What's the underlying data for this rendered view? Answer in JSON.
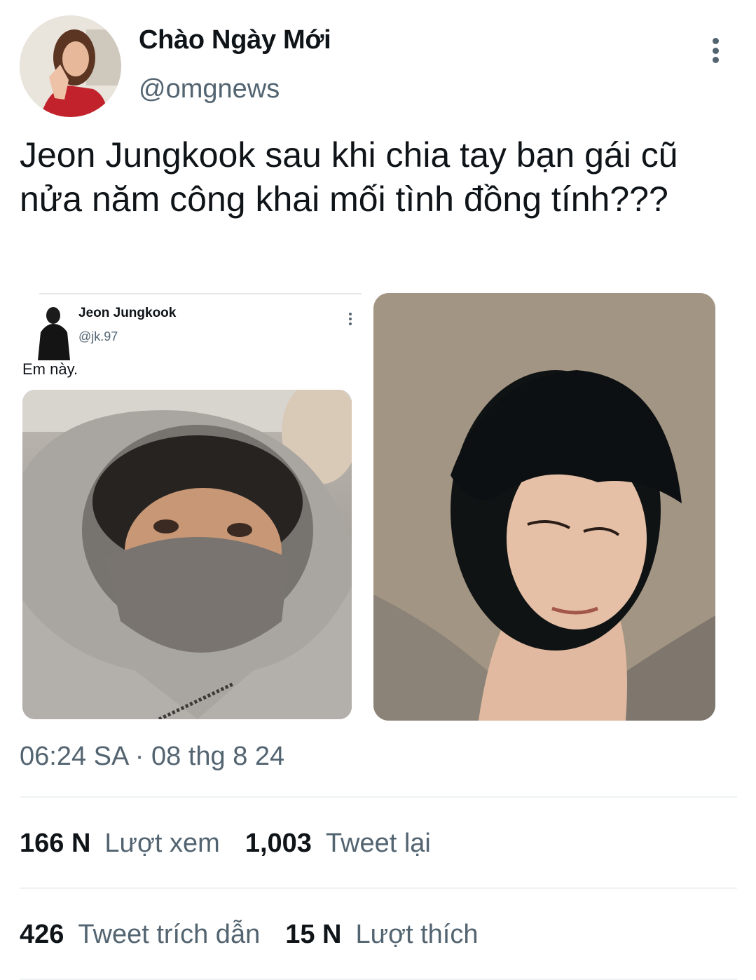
{
  "author": {
    "display_name": "Chào Ngày Mới",
    "handle": "@omgnews",
    "avatar_icon": "profile-photo"
  },
  "tweet": {
    "text": "Jeon Jungkook sau khi chia tay bạn gái cũ nửa năm công khai mối tình đồng tính???",
    "timestamp": "06:24 SA · 08 thg 8 24"
  },
  "embedded_tweet": {
    "display_name": "Jeon Jungkook",
    "handle": "@jk.97",
    "text": "Em này."
  },
  "stats": {
    "views_count": "166 N",
    "views_label": "Lượt xem",
    "retweets_count": "1,003",
    "retweets_label": "Tweet lại",
    "quotes_count": "426",
    "quotes_label": "Tweet trích dẫn",
    "likes_count": "15 N",
    "likes_label": "Lượt thích"
  },
  "colors": {
    "text_primary": "#0f1419",
    "text_secondary": "#536471",
    "divider": "#eff3f4"
  }
}
